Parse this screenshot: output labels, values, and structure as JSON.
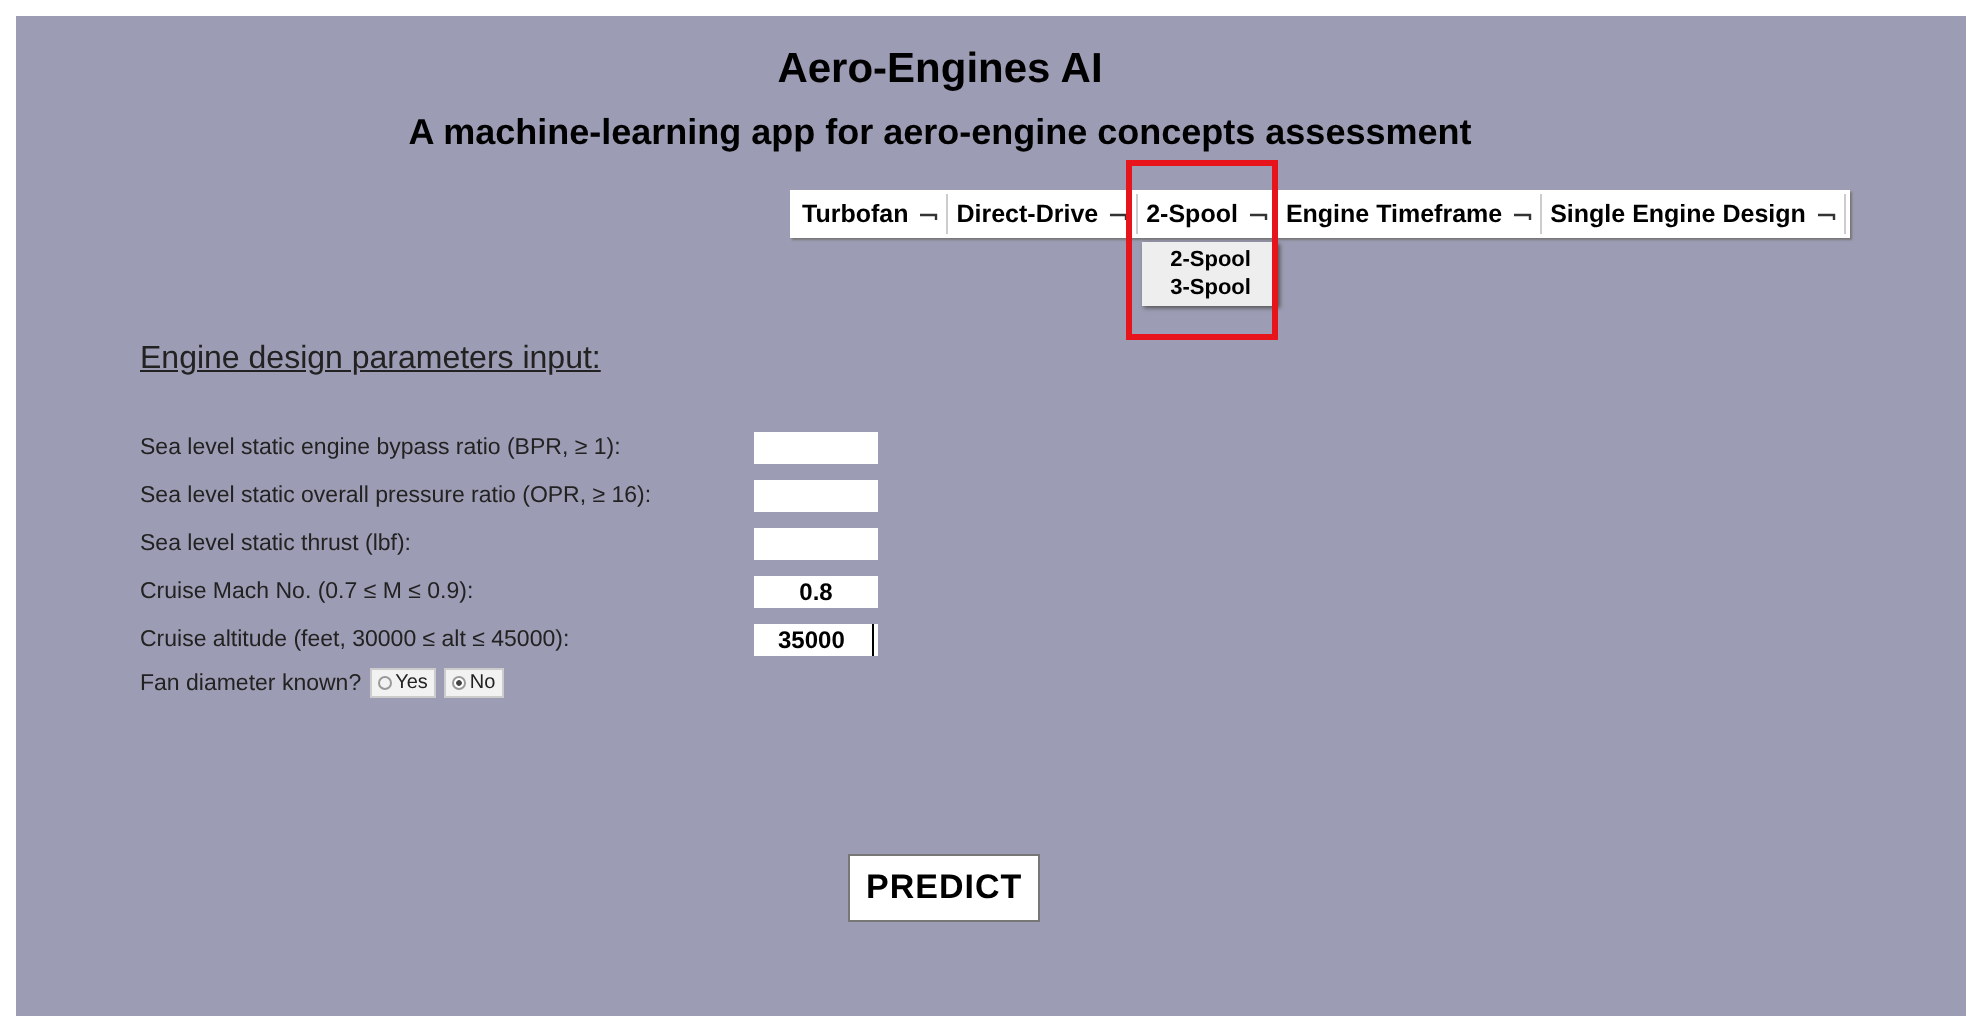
{
  "title": "Aero-Engines AI",
  "subtitle": "A machine-learning app for aero-engine concepts assessment",
  "menus": [
    {
      "label": "Turbofan",
      "highlighted": false
    },
    {
      "label": "Direct-Drive",
      "highlighted": false
    },
    {
      "label": "2-Spool",
      "highlighted": true,
      "options": [
        "2-Spool",
        "3-Spool"
      ]
    },
    {
      "label": "Engine Timeframe",
      "highlighted": false
    },
    {
      "label": "Single Engine Design",
      "highlighted": false
    }
  ],
  "section_heading": "Engine design parameters input:",
  "fields": [
    {
      "label": "Sea level static engine bypass ratio (BPR, ≥ 1):"
    },
    {
      "label": "Sea level static overall pressure ratio (OPR, ≥ 16):"
    },
    {
      "label": "Sea level static thrust (lbf):"
    },
    {
      "label": "Cruise Mach No. (0.7 ≤ M ≤ 0.9):",
      "value": "0.8"
    },
    {
      "label": "Cruise altitude (feet, 30000 ≤ alt ≤ 45000):",
      "value": "35000",
      "focused": true
    }
  ],
  "fan_diameter": {
    "label": "Fan diameter known?",
    "options": [
      {
        "label": "Yes",
        "selected": false
      },
      {
        "label": "No",
        "selected": true
      }
    ]
  },
  "predict_button": "PREDICT"
}
